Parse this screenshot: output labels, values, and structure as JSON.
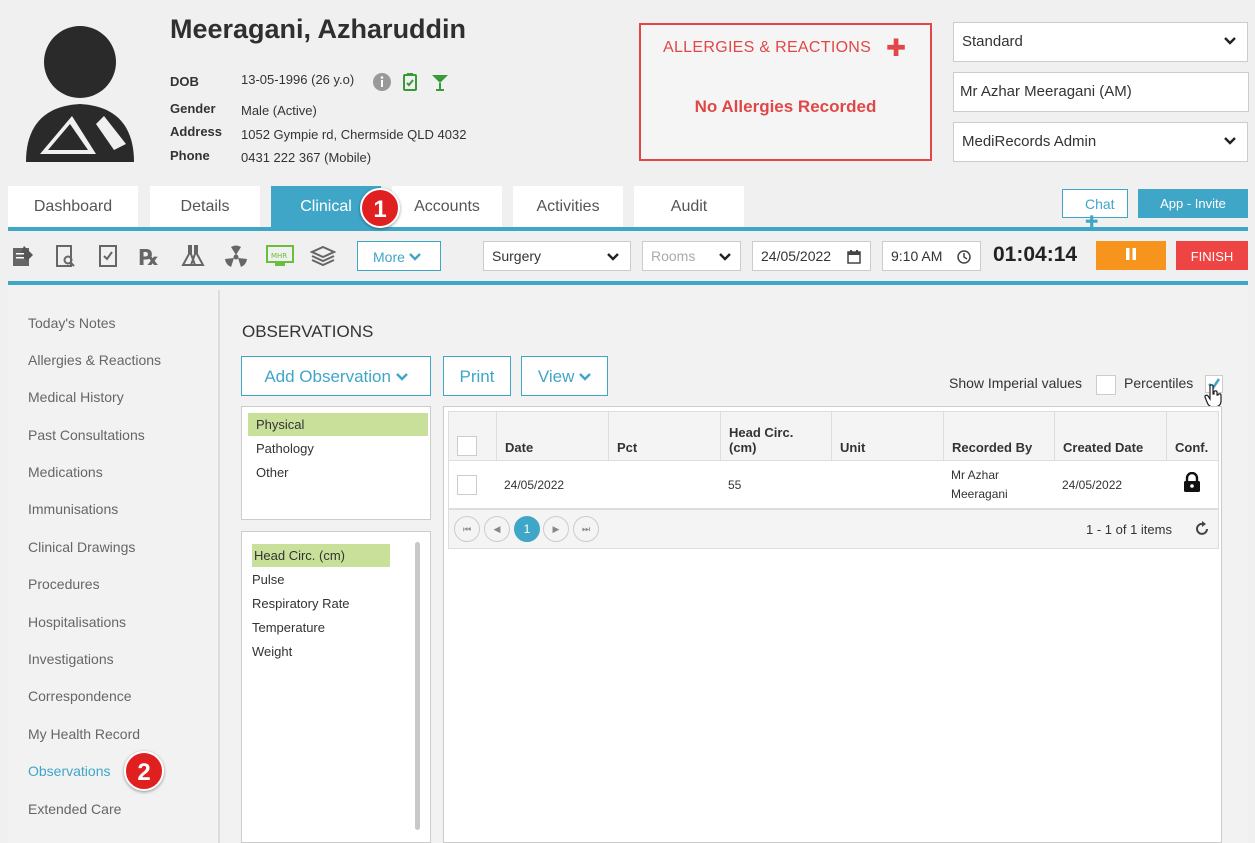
{
  "patient": {
    "name": "Meeragani, Azharuddin",
    "dob_label": "DOB",
    "dob": "13-05-1996 (26 y.o)",
    "gender_label": "Gender",
    "gender": "Male (Active)",
    "address_label": "Address",
    "address": "1052 Gympie rd, Chermside QLD 4032",
    "phone_label": "Phone",
    "phone": "0431 222 367 (Mobile)"
  },
  "allergies": {
    "title": "ALLERGIES & REACTIONS",
    "status": "No Allergies Recorded"
  },
  "selectors": {
    "template": "Standard",
    "practitioner": "Mr Azhar Meeragani (AM)",
    "role": "MediRecords Admin"
  },
  "tabs": [
    {
      "label": "Dashboard"
    },
    {
      "label": "Details"
    },
    {
      "label": "Clinical"
    },
    {
      "label": "Accounts"
    },
    {
      "label": "Activities"
    },
    {
      "label": "Audit"
    }
  ],
  "header_buttons": {
    "chat": "Chat",
    "invite": "App - Invite"
  },
  "toolbar": {
    "more": "More",
    "location": "Surgery",
    "rooms_placeholder": "Rooms",
    "date": "24/05/2022",
    "time": "9:10 AM",
    "timer": "01:04:14",
    "finish": "FINISH",
    "mhr_icon_text": "MHR"
  },
  "sidebar": {
    "items": [
      {
        "label": "Today's Notes"
      },
      {
        "label": "Allergies & Reactions"
      },
      {
        "label": "Medical History"
      },
      {
        "label": "Past Consultations"
      },
      {
        "label": "Medications"
      },
      {
        "label": "Immunisations"
      },
      {
        "label": "Clinical Drawings"
      },
      {
        "label": "Procedures"
      },
      {
        "label": "Hospitalisations"
      },
      {
        "label": "Investigations"
      },
      {
        "label": "Correspondence"
      },
      {
        "label": "My Health Record"
      },
      {
        "label": "Observations"
      },
      {
        "label": "Extended Care"
      }
    ],
    "active": "Observations"
  },
  "observations": {
    "title": "OBSERVATIONS",
    "add_button": "Add Observation",
    "print_button": "Print",
    "view_button": "View",
    "show_imperial": "Show Imperial values",
    "percentiles": "Percentiles",
    "categories": [
      "Physical",
      "Pathology",
      "Other"
    ],
    "selected_category": "Physical",
    "types": [
      "Head Circ. (cm)",
      "Pulse",
      "Respiratory Rate",
      "Temperature",
      "Weight"
    ],
    "selected_type": "Head Circ. (cm)",
    "columns": [
      "Date",
      "Pct",
      "Head Circ.\n(cm)",
      "Unit",
      "Recorded By",
      "Created Date",
      "Conf."
    ],
    "col_head_circ_1": "Head Circ.",
    "col_head_circ_2": "(cm)",
    "rows": [
      {
        "date": "24/05/2022",
        "pct": "",
        "head_circ": "55",
        "unit": "",
        "recorded_by_1": "Mr Azhar",
        "recorded_by_2": "Meeragani",
        "created_date": "24/05/2022"
      }
    ],
    "current_page": "1",
    "items_text": "1 - 1 of 1 items"
  },
  "annotations": {
    "badge_1": "1",
    "badge_2": "2"
  },
  "colors": {
    "accent": "#40a6c8",
    "danger": "#e04848",
    "pause": "#f7941d",
    "selected_item": "#c8e09a"
  }
}
